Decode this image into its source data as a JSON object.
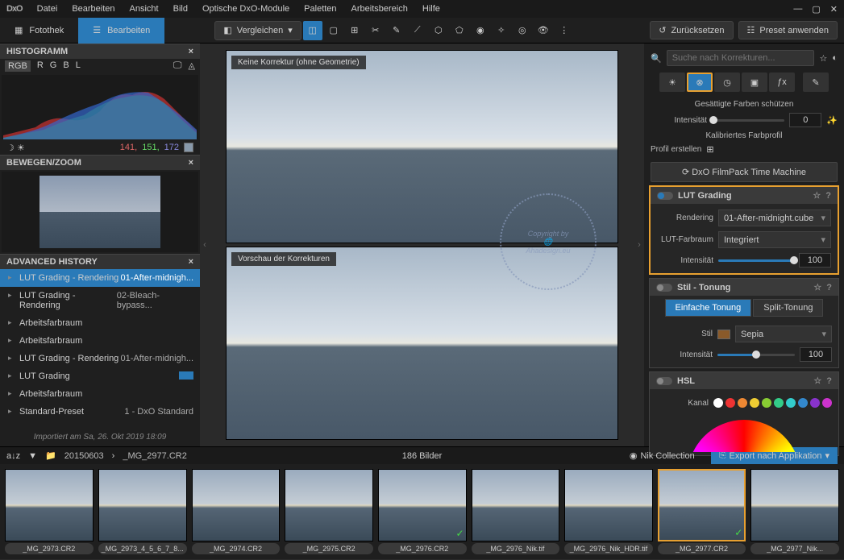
{
  "menu": {
    "items": [
      "Datei",
      "Bearbeiten",
      "Ansicht",
      "Bild",
      "Optische DxO-Module",
      "Paletten",
      "Arbeitsbereich",
      "Hilfe"
    ]
  },
  "tabs": {
    "fotothek": "Fotothek",
    "bearbeiten": "Bearbeiten"
  },
  "toolbar": {
    "compare": "Vergleichen",
    "reset": "Zurücksetzen",
    "preset": "Preset anwenden"
  },
  "panels": {
    "histogram": {
      "title": "HISTOGRAMM",
      "channels": [
        "RGB",
        "R",
        "G",
        "B",
        "L"
      ],
      "r": "141,",
      "g": "151,",
      "b": "172"
    },
    "zoom": {
      "title": "BEWEGEN/ZOOM"
    },
    "history": {
      "title": "ADVANCED HISTORY",
      "items": [
        {
          "label": "LUT Grading - Rendering",
          "val": "01-After-midnigh..."
        },
        {
          "label": "LUT Grading - Rendering",
          "val": "02-Bleach-bypass..."
        },
        {
          "label": "Arbeitsfarbraum",
          "val": ""
        },
        {
          "label": "Arbeitsfarbraum",
          "val": ""
        },
        {
          "label": "LUT Grading - Rendering",
          "val": "01-After-midnigh..."
        },
        {
          "label": "LUT Grading",
          "val": ""
        },
        {
          "label": "Arbeitsfarbraum",
          "val": ""
        },
        {
          "label": "Standard-Preset",
          "val": "1 - DxO Standard"
        }
      ],
      "footer": "Importiert am Sa, 26. Okt 2019 18:09"
    }
  },
  "viewer": {
    "label1": "Keine Korrektur (ohne Geometrie)",
    "label2": "Vorschau der Korrekturen"
  },
  "right": {
    "search_ph": "Suche nach Korrekturen...",
    "sat_title": "Gesättigte Farben schützen",
    "intensity": "Intensität",
    "intensity_val": "0",
    "calib": "Kalibriertes Farbprofil",
    "profile": "Profil erstellen",
    "timemachine": "DxO FilmPack Time Machine",
    "lut": {
      "title": "LUT Grading",
      "render_lbl": "Rendering",
      "render_val": "01-After-midnight.cube",
      "space_lbl": "LUT-Farbraum",
      "space_val": "Integriert",
      "int_lbl": "Intensität",
      "int_val": "100"
    },
    "style": {
      "title": "Stil - Tonung",
      "simple": "Einfache Tonung",
      "split": "Split-Tonung",
      "stil_lbl": "Stil",
      "stil_val": "Sepia",
      "int_lbl": "Intensität",
      "int_val": "100"
    },
    "hsl": {
      "title": "HSL",
      "kanal": "Kanal"
    }
  },
  "bottom": {
    "folder": "20150603",
    "file": "_MG_2977.CR2",
    "count": "186 Bilder",
    "nik": "Nik Collection",
    "export": "Export nach Applikation"
  },
  "film": [
    {
      "name": "_MG_2973.CR2"
    },
    {
      "name": "_MG_2973_4_5_6_7_8..."
    },
    {
      "name": "_MG_2974.CR2"
    },
    {
      "name": "_MG_2975.CR2"
    },
    {
      "name": "_MG_2976.CR2",
      "check": true
    },
    {
      "name": "_MG_2976_Nik.tif"
    },
    {
      "name": "_MG_2976_Nik_HDR.tif"
    },
    {
      "name": "_MG_2977.CR2",
      "active": true,
      "check": true
    },
    {
      "name": "_MG_2977_Nik..."
    }
  ],
  "colors": [
    "#fff",
    "#e33",
    "#e83",
    "#ec3",
    "#8c3",
    "#3c8",
    "#3cc",
    "#38c",
    "#83c",
    "#c3c"
  ]
}
